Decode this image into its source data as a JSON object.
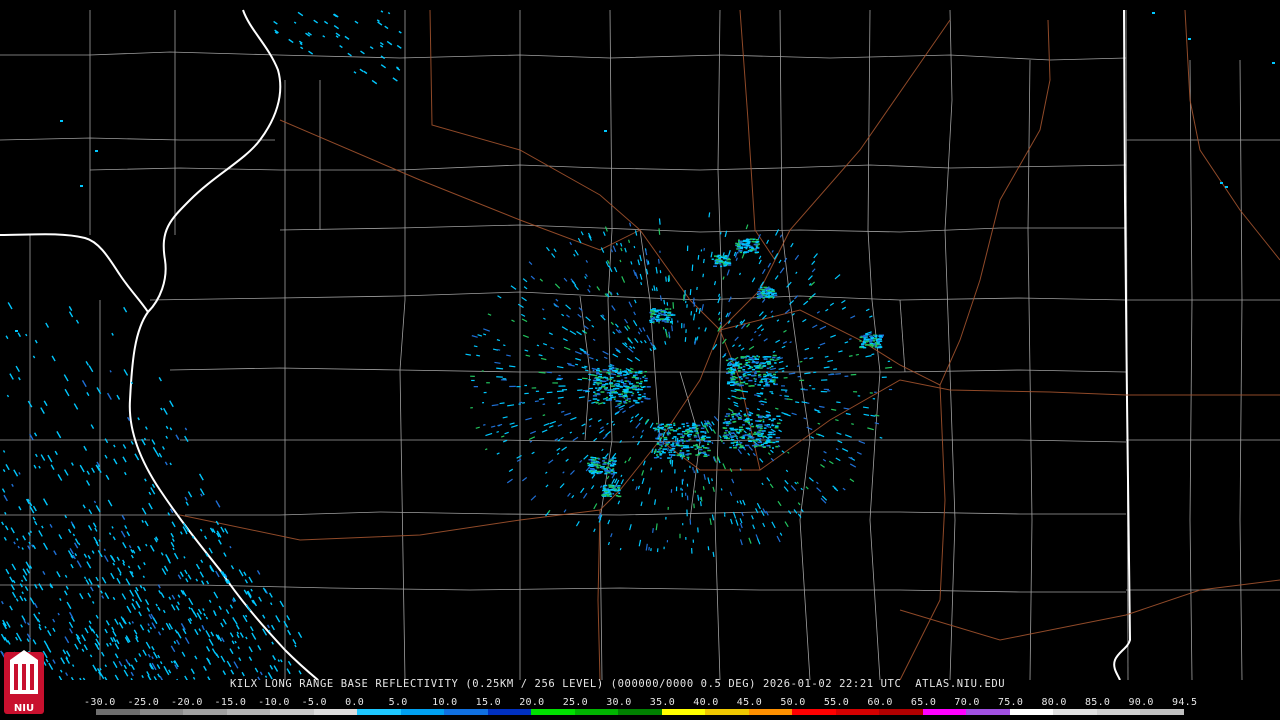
{
  "caption": "KILX LONG RANGE BASE REFLECTIVITY (0.25KM / 256 LEVEL) (000000/0000 0.5 DEG) 2026-01-02 22:21 UTC  ATLAS.NIU.EDU",
  "logo": {
    "text": "NIU",
    "color": "#c8102e"
  },
  "scale": {
    "labels": [
      "-30.0",
      "-25.0",
      "-20.0",
      "-15.0",
      "-10.0",
      "-5.0",
      "0.0",
      "5.0",
      "10.0",
      "15.0",
      "20.0",
      "25.0",
      "30.0",
      "35.0",
      "40.0",
      "45.0",
      "50.0",
      "55.0",
      "60.0",
      "65.0",
      "70.0",
      "75.0",
      "80.0",
      "85.0",
      "90.0",
      "94.5"
    ],
    "colors": [
      "#6e6e6e",
      "#8a8a8a",
      "#a0a0a0",
      "#b4b4b4",
      "#c8c8c8",
      "#dcdcdc",
      "#1ec8ff",
      "#00a0f0",
      "#1070e0",
      "#0030c0",
      "#00e000",
      "#00b400",
      "#008000",
      "#ffff00",
      "#f0c800",
      "#ff9000",
      "#ff0000",
      "#d40000",
      "#b00000",
      "#ff00ff",
      "#a050e0",
      "#ffffff",
      "#e0e0e0",
      "#d0d0d0",
      "#c0c0c0"
    ]
  },
  "map_colors": {
    "background": "#000000",
    "county_lines": "#bdbdbd",
    "state_lines": "#ffffff",
    "highways": "#a0522d",
    "echo_light": "#00c8ff",
    "echo_medium": "#1f6fd6",
    "echo_strong": "#22c55e"
  }
}
